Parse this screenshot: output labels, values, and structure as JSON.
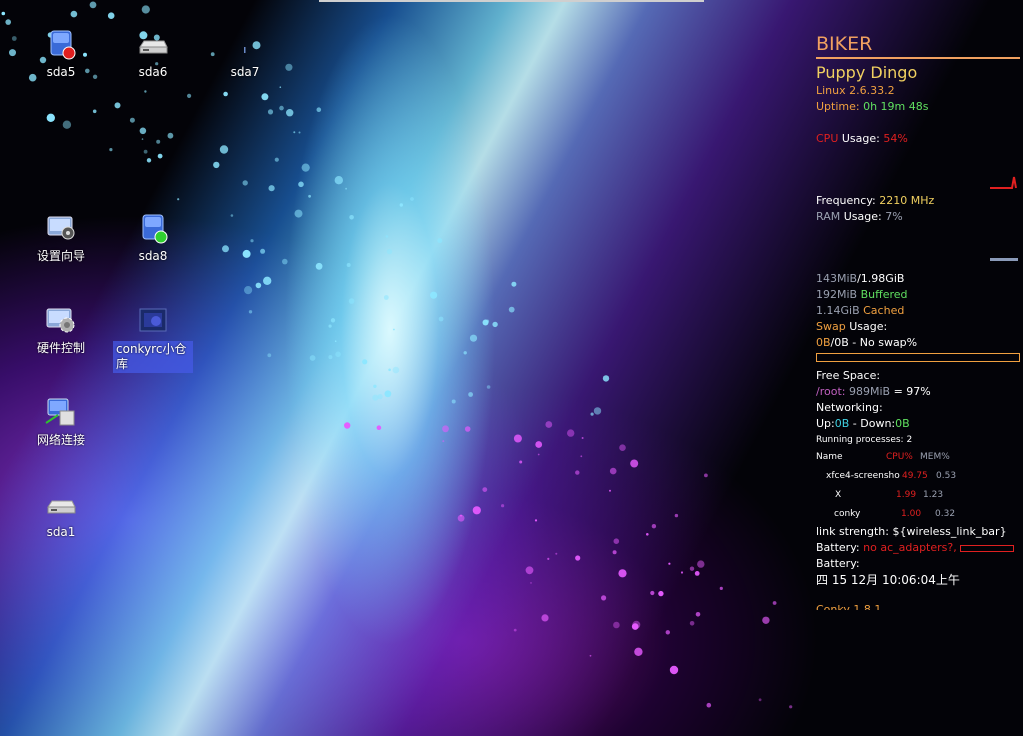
{
  "desktop": {
    "icons": [
      {
        "label": "sda5"
      },
      {
        "label": "sda6"
      },
      {
        "label": "sda7"
      },
      {
        "label": "设置向导"
      },
      {
        "label": "sda8"
      },
      {
        "label": "硬件控制"
      },
      {
        "label": "conkyrc小仓库"
      },
      {
        "label": "网络连接"
      },
      {
        "label": "sda1"
      }
    ]
  },
  "conky": {
    "user": "BIKER",
    "distro": "Puppy Dingo",
    "kernel": "Linux 2.6.33.2",
    "uptime_label": "Uptime:",
    "uptime_value": "0h 19m 48s",
    "cpu_label": "CPU",
    "usage_label": "Usage:",
    "cpu_value": "54%",
    "freq_label": "Frequency:",
    "freq_value": "2210 MHz",
    "ram_label": "RAM",
    "ram_value": "7%",
    "mem_used": "143MiB",
    "mem_total": "/1.98GiB",
    "buffered_value": "192MiB",
    "buffered_label": "Buffered",
    "cached_value": "1.14GiB",
    "cached_label": "Cached",
    "swap_label": "Swap",
    "swap_usage_label": "Usage:",
    "swap_used": "0B",
    "swap_rest": "/0B - No swap%",
    "swap_fill": 0,
    "free_space_label": "Free Space:",
    "root_label": "/root:",
    "root_value": "989MiB",
    "root_percent": "= 97%",
    "networking_label": "Networking:",
    "up_label": "Up:",
    "up_value": "0B",
    "down_label": "- Down:",
    "down_value": "0B",
    "running_procs": "Running processes: 2",
    "procs_header": {
      "name": "Name",
      "cpu": "CPU%",
      "mem": "MEM%"
    },
    "processes": [
      {
        "name": "xfce4-screensho",
        "cpu": "49.75",
        "mem": "0.53"
      },
      {
        "name": "X",
        "cpu": "1.99",
        "mem": "1.23"
      },
      {
        "name": "conky",
        "cpu": "1.00",
        "mem": "0.32"
      }
    ],
    "link_strength": "link strength:  ${wireless_link_bar}",
    "battery_label": "Battery:",
    "battery_value": "no ac_adapters?,",
    "battery2_label": "Battery:",
    "datetime": "四 15 12月 10:06:04上午",
    "version": "Conky 1.8.1",
    "colors": {
      "accent": "#f0a060",
      "cpu": "#e02020",
      "green": "#60e060",
      "grey": "#9aa0b0"
    }
  }
}
